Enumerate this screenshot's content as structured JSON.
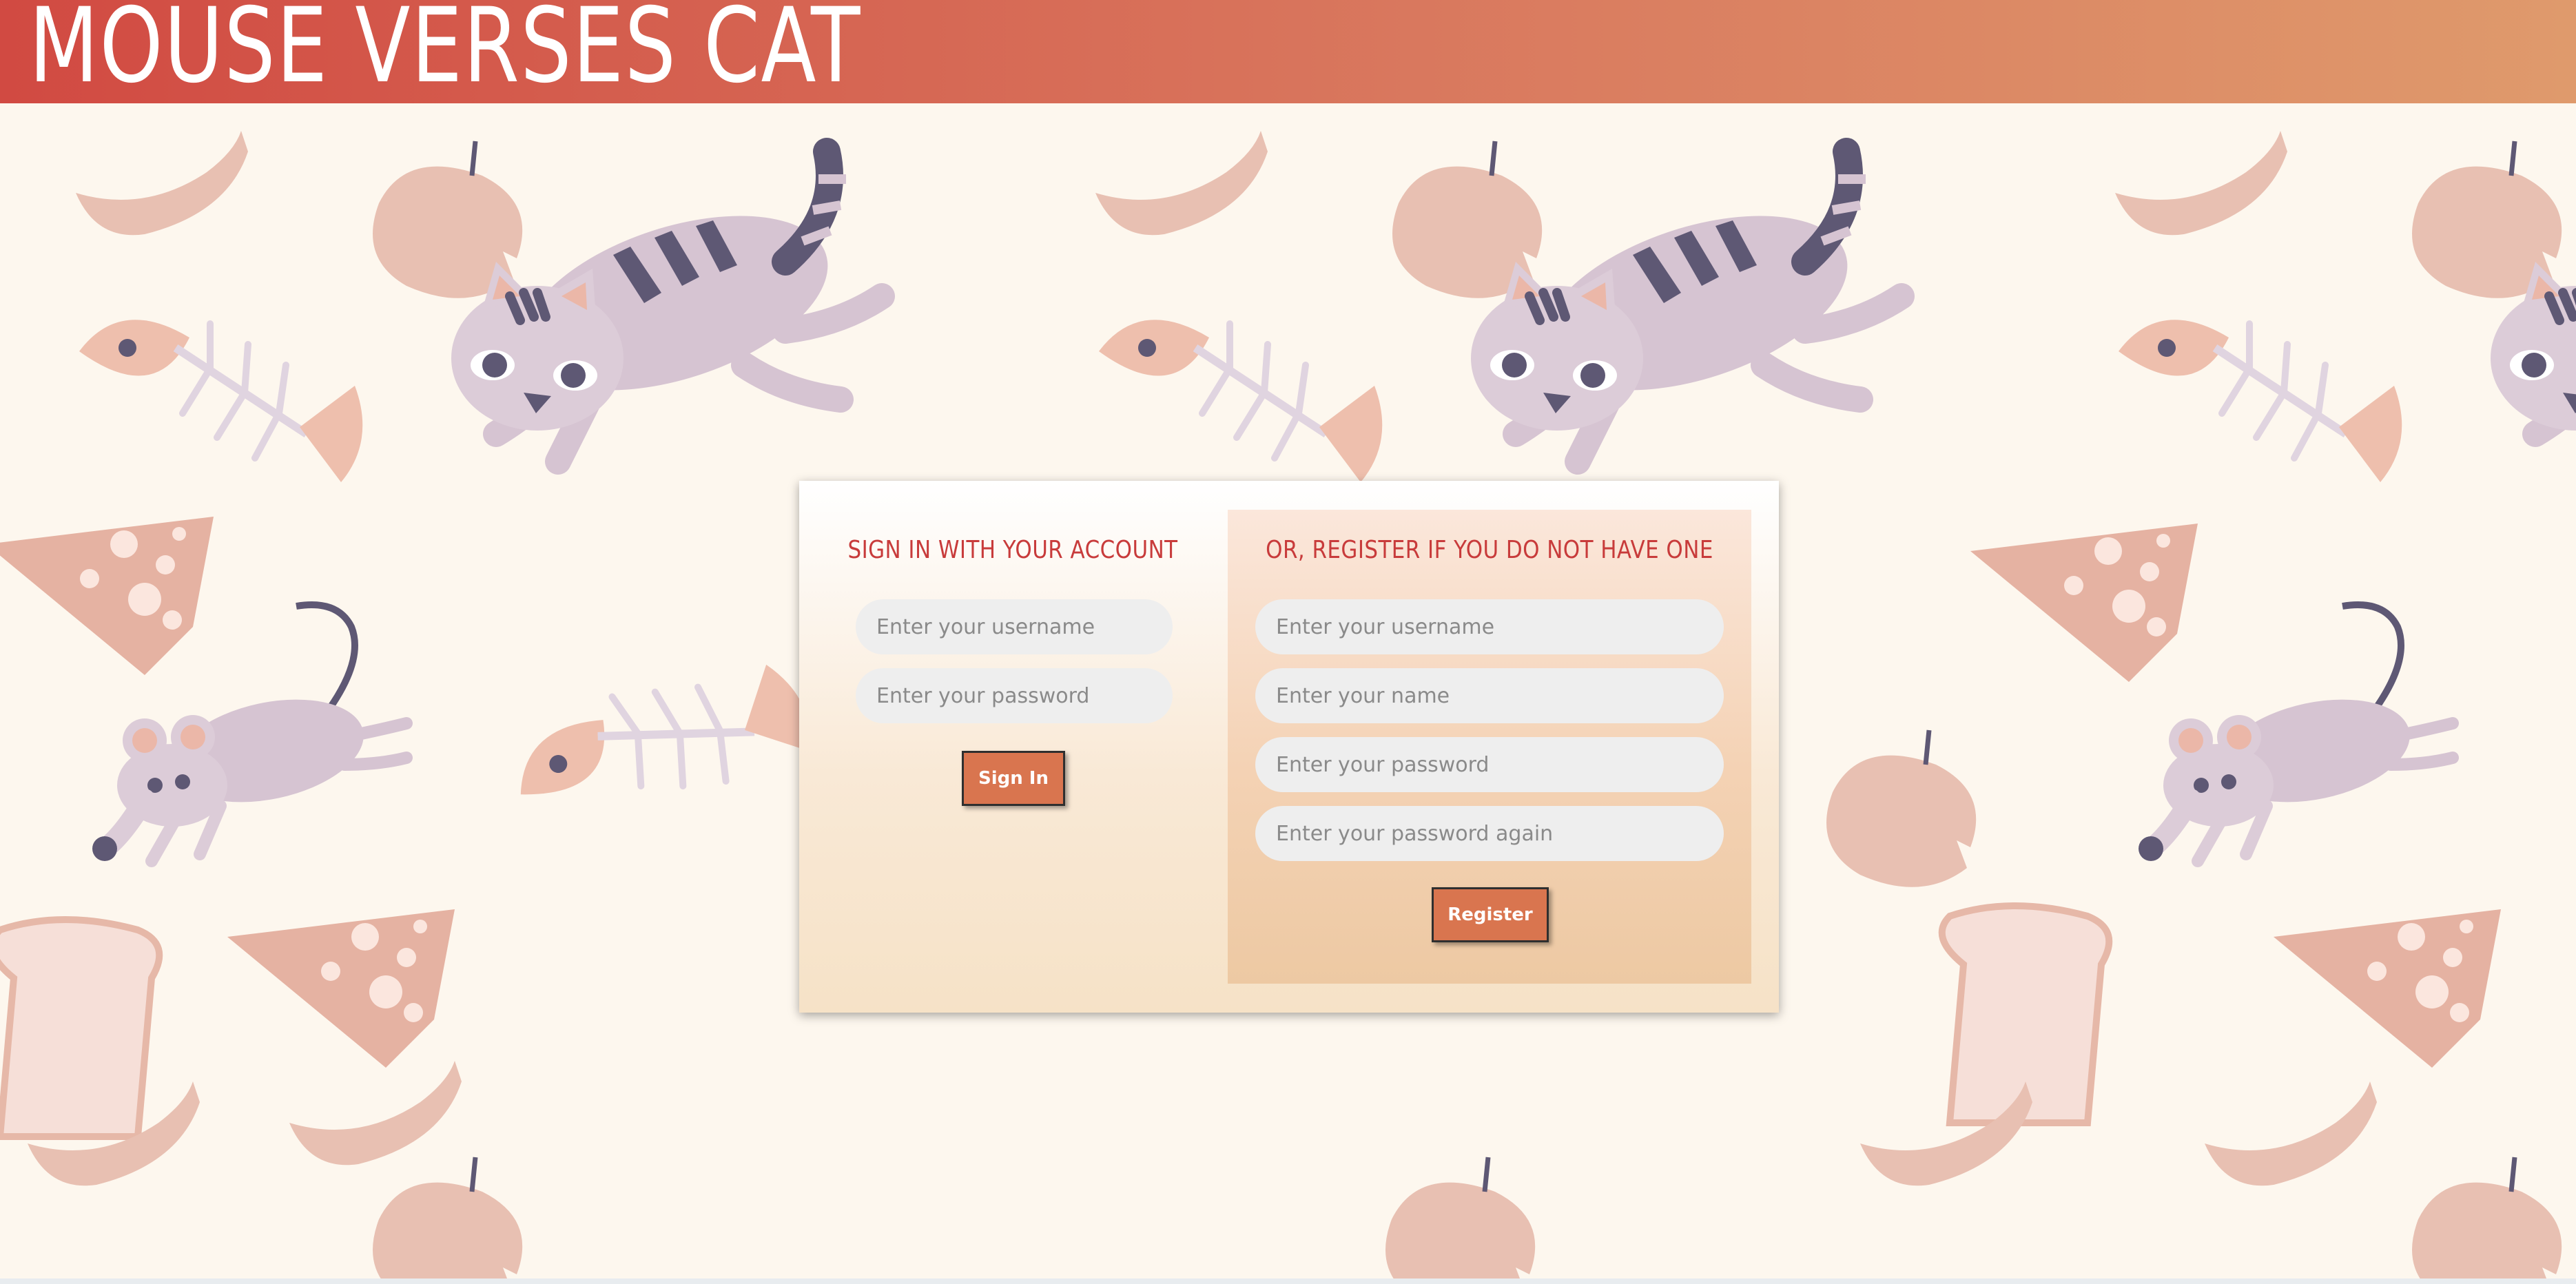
{
  "header": {
    "title": "MOUSE VERSES CAT"
  },
  "signin": {
    "heading": "SIGN IN WITH YOUR ACCOUNT",
    "username_placeholder": "Enter your username",
    "password_placeholder": "Enter your password",
    "button_label": "Sign In"
  },
  "register": {
    "heading": "OR, REGISTER IF YOU DO NOT HAVE ONE",
    "username_placeholder": "Enter your username",
    "name_placeholder": "Enter your name",
    "password_placeholder": "Enter your password",
    "password_again_placeholder": "Enter your password again",
    "button_label": "Register"
  },
  "colors": {
    "header_start": "#d14a42",
    "header_end": "#df9a6c",
    "heading_text": "#c83b3b",
    "button_bg": "#d9754f",
    "page_bg": "#fdf7ee"
  },
  "background_icons": [
    "cat-icon",
    "mouse-icon",
    "fish-bone-icon",
    "apple-icon",
    "cheese-icon",
    "bread-icon",
    "sausage-icon",
    "apple-core-icon"
  ]
}
